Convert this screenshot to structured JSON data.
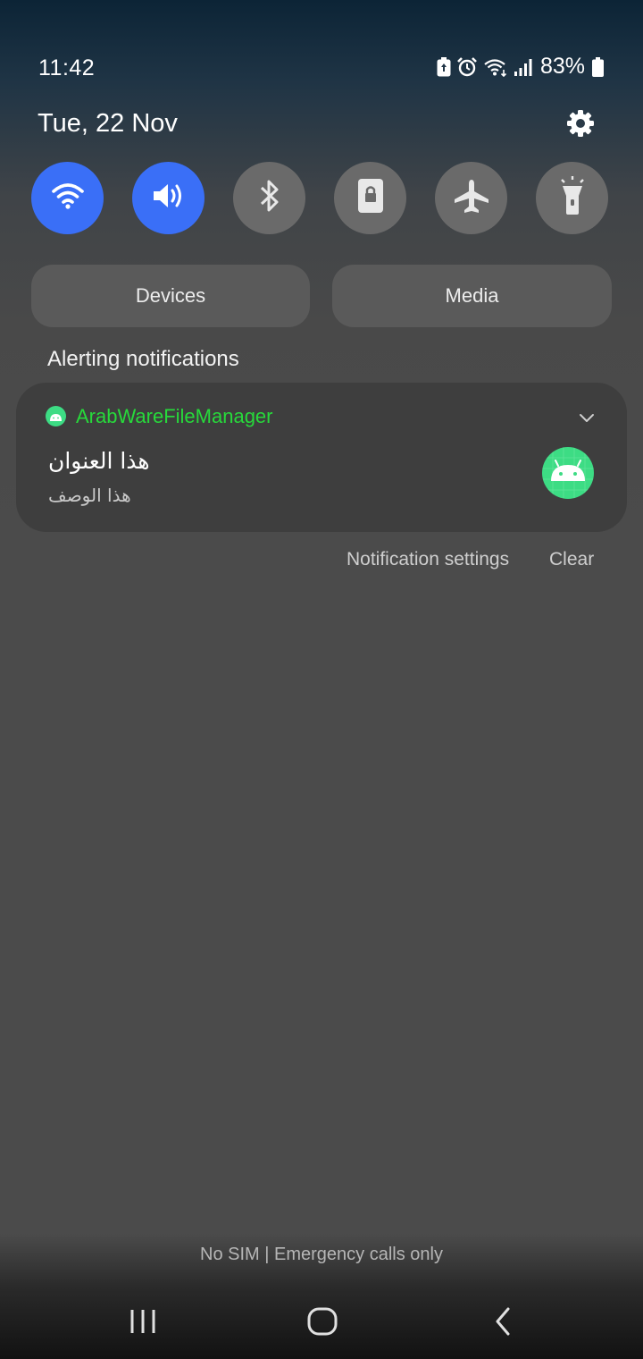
{
  "status_bar": {
    "time": "11:42",
    "battery_percent": "83%",
    "icons": [
      "battery-saver-icon",
      "alarm-icon",
      "wifi-icon",
      "cellular-signal-icon",
      "battery-icon"
    ]
  },
  "header": {
    "date": "Tue, 22 Nov"
  },
  "quick_settings": {
    "tiles": [
      {
        "name": "wifi",
        "active": true
      },
      {
        "name": "sound",
        "active": true
      },
      {
        "name": "bluetooth",
        "active": false
      },
      {
        "name": "screen-lock",
        "active": false
      },
      {
        "name": "airplane-mode",
        "active": false
      },
      {
        "name": "flashlight",
        "active": false
      }
    ],
    "active_color": "#3a6ff7",
    "inactive_color": "#6a6a6a"
  },
  "panels": {
    "devices_label": "Devices",
    "media_label": "Media"
  },
  "notifications": {
    "section_title": "Alerting notifications",
    "items": [
      {
        "app_name": "ArabWareFileManager",
        "title": "هذا العنوان",
        "description": "هذا الوصف",
        "app_color": "#27d93b"
      }
    ],
    "settings_label": "Notification settings",
    "clear_label": "Clear"
  },
  "footer": {
    "carrier_text": "No SIM | Emergency calls only"
  }
}
